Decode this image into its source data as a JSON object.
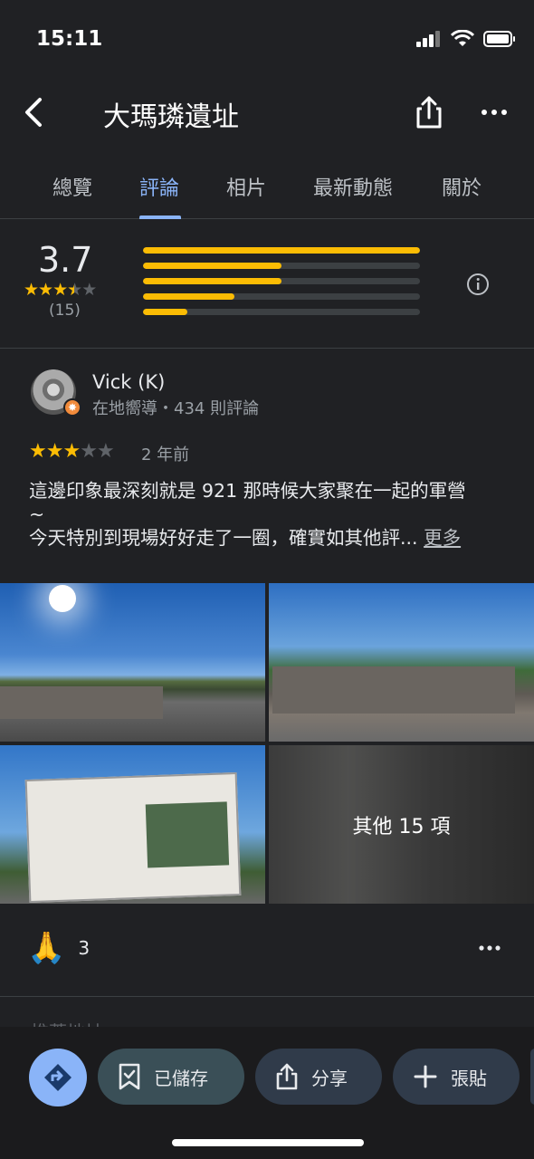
{
  "status_bar": {
    "time": "15:11"
  },
  "header": {
    "title": "大瑪璘遺址"
  },
  "tabs": [
    {
      "label": "總覽"
    },
    {
      "label": "評論"
    },
    {
      "label": "相片"
    },
    {
      "label": "最新動態"
    },
    {
      "label": "關於"
    }
  ],
  "active_tab": "評論",
  "rating_summary": {
    "average": "3.7",
    "count": "(15)",
    "star_value": 3.5,
    "distribution": [
      {
        "stars": 5,
        "fraction": 1.0
      },
      {
        "stars": 4,
        "fraction": 0.5
      },
      {
        "stars": 3,
        "fraction": 0.5
      },
      {
        "stars": 2,
        "fraction": 0.33
      },
      {
        "stars": 1,
        "fraction": 0.16
      }
    ]
  },
  "review": {
    "reviewer": "Vick (K)",
    "meta": "在地嚮導・434 則評論",
    "stars": 3,
    "date": "2 年前",
    "text_lines": [
      "這邊印象最深刻就是 921 那時候大家聚在一起的軍營",
      "~",
      "今天特別到現場好好走了一圈，確實如其他評..."
    ],
    "more_label": "更多",
    "photos_more": "其他 15 項",
    "reaction_count": "3"
  },
  "next_section_peek": "推薦地址",
  "actions": {
    "saved": "已儲存",
    "share": "分享",
    "paste": "張貼"
  },
  "colors": {
    "background": "#202124",
    "accent_blue": "#8ab4f8",
    "star_yellow": "#fbbc04"
  }
}
